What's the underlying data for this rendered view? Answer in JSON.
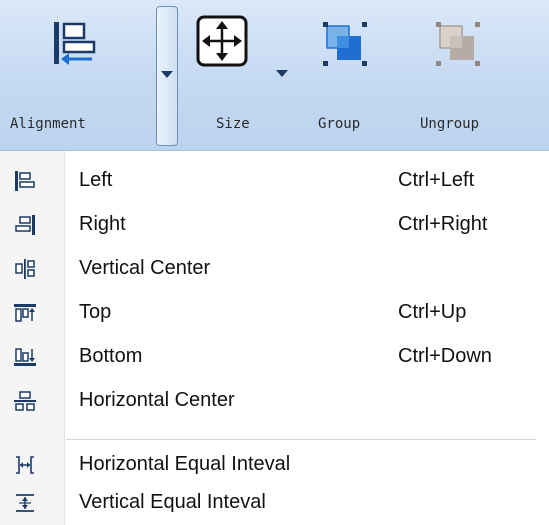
{
  "ribbon": {
    "alignment_label": "Alignment",
    "size_label": "Size",
    "group_label": "Group",
    "ungroup_label": "Ungroup"
  },
  "menu": {
    "items": [
      {
        "label": "Left",
        "shortcut": "Ctrl+Left",
        "icon": "align-left-icon"
      },
      {
        "label": "Right",
        "shortcut": "Ctrl+Right",
        "icon": "align-right-icon"
      },
      {
        "label": "Vertical Center",
        "shortcut": "",
        "icon": "align-vertical-center-icon"
      },
      {
        "label": "Top",
        "shortcut": "Ctrl+Up",
        "icon": "align-top-icon"
      },
      {
        "label": "Bottom",
        "shortcut": "Ctrl+Down",
        "icon": "align-bottom-icon"
      },
      {
        "label": "Horizontal Center",
        "shortcut": "",
        "icon": "align-horizontal-center-icon"
      },
      {
        "label": "Horizontal Equal Inteval",
        "shortcut": "",
        "icon": "horizontal-equal-interval-icon"
      },
      {
        "label": "Vertical Equal Inteval",
        "shortcut": "",
        "icon": "vertical-equal-interval-icon"
      }
    ]
  },
  "colors": {
    "ribbon_bg": "#c4d9f2",
    "icon_dark": "#1c3a66",
    "icon_blue": "#1e6fd0"
  }
}
